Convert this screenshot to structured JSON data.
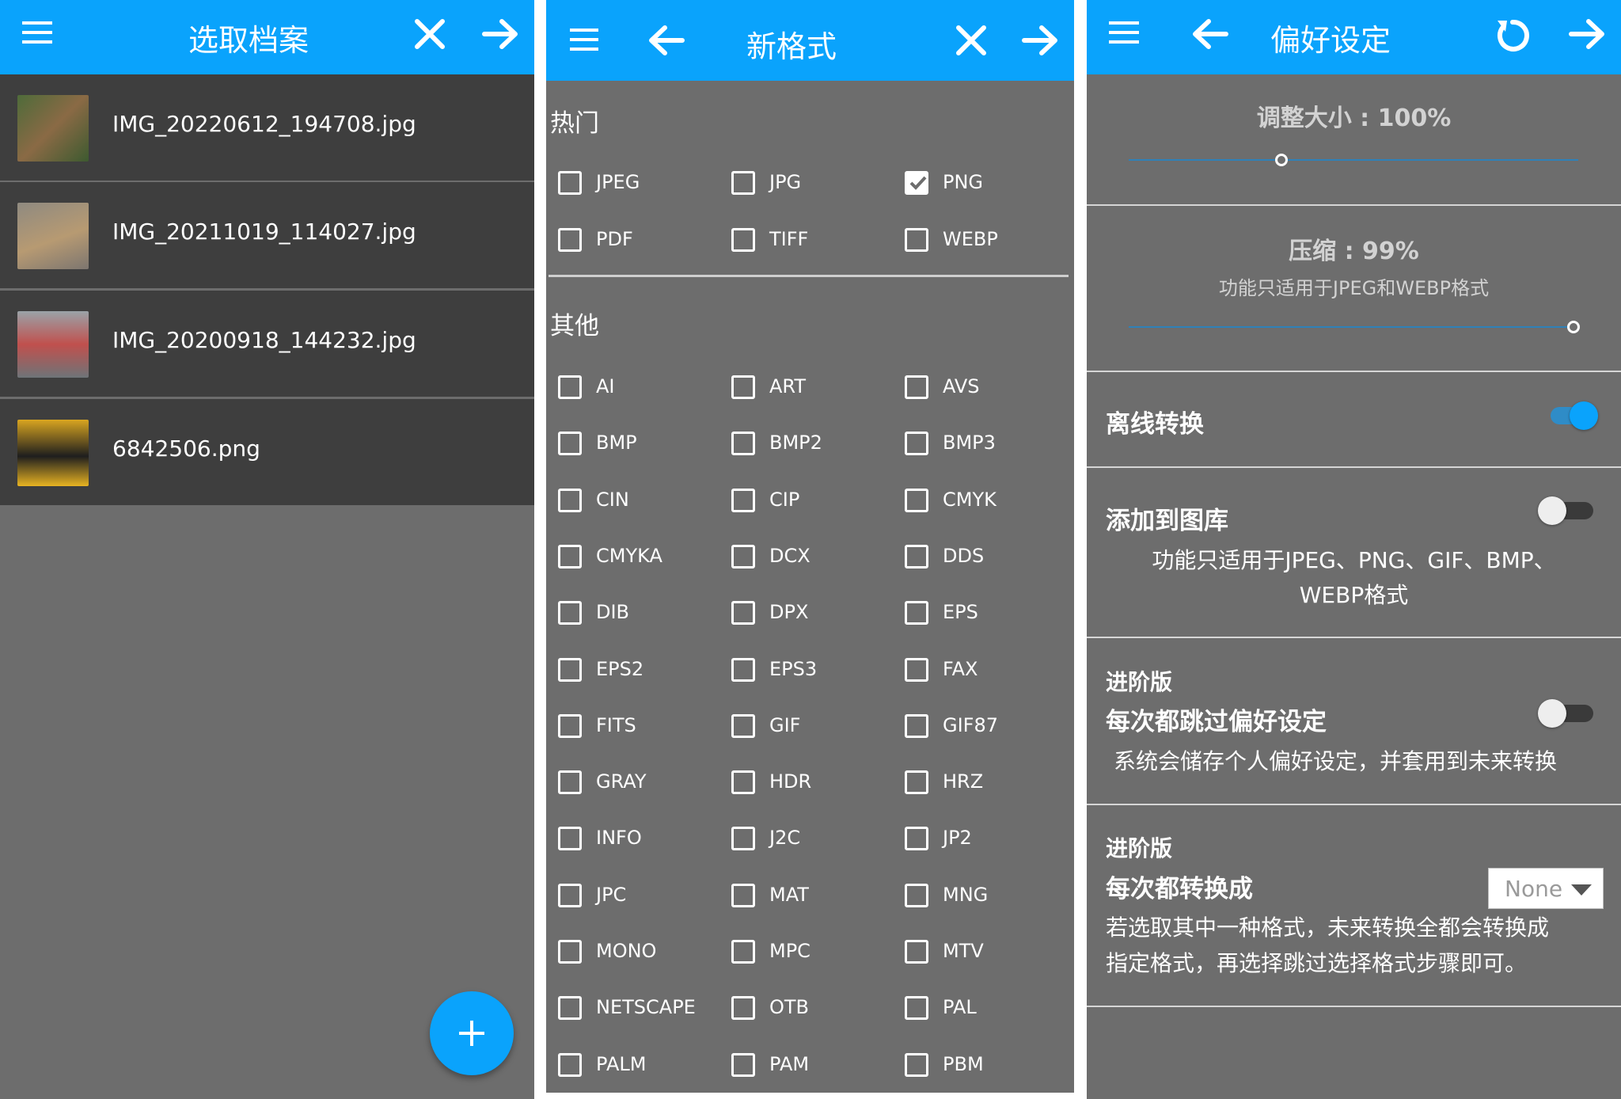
{
  "colors": {
    "accent": "#0aa3fc",
    "panel_bg": "#6d6d6d",
    "row_bg": "#3e3e3e",
    "toggle_on": "#0aa3fc",
    "toggle_off": "#eeeeee"
  },
  "file_picker": {
    "title": "选取档案",
    "files": [
      {
        "name": "IMG_20220612_194708.jpg"
      },
      {
        "name": "IMG_20211019_114027.jpg"
      },
      {
        "name": "IMG_20200918_144232.jpg"
      },
      {
        "name": "6842506.png"
      }
    ],
    "fab_label": "+"
  },
  "format_picker": {
    "title": "新格式",
    "popular_label": "热门",
    "popular": [
      {
        "label": "JPEG",
        "checked": false
      },
      {
        "label": "JPG",
        "checked": false
      },
      {
        "label": "PNG",
        "checked": true
      },
      {
        "label": "PDF",
        "checked": false
      },
      {
        "label": "TIFF",
        "checked": false
      },
      {
        "label": "WEBP",
        "checked": false
      }
    ],
    "other_label": "其他",
    "other": [
      "AI",
      "ART",
      "AVS",
      "BMP",
      "BMP2",
      "BMP3",
      "CIN",
      "CIP",
      "CMYK",
      "CMYKA",
      "DCX",
      "DDS",
      "DIB",
      "DPX",
      "EPS",
      "EPS2",
      "EPS3",
      "FAX",
      "FITS",
      "GIF",
      "GIF87",
      "GRAY",
      "HDR",
      "HRZ",
      "INFO",
      "J2C",
      "JP2",
      "JPC",
      "MAT",
      "MNG",
      "MONO",
      "MPC",
      "MTV",
      "NETSCAPE",
      "OTB",
      "PAL",
      "PALM",
      "PAM",
      "PBM"
    ]
  },
  "preferences": {
    "title": "偏好设定",
    "resize": {
      "label": "调整大小 : 100%",
      "value_percent": 100,
      "slider_fraction": 0.34
    },
    "compress": {
      "label": "压缩 : 99%",
      "value_percent": 99,
      "note": "功能只适用于JPEG和WEBP格式",
      "slider_fraction": 0.99
    },
    "offline": {
      "title": "离线转换",
      "enabled": true
    },
    "gallery": {
      "title": "添加到图库",
      "enabled": false,
      "note_line1": "功能只适用于JPEG、PNG、GIF、BMP、",
      "note_line2": "WEBP格式"
    },
    "skip": {
      "tag": "进阶版",
      "title": "每次都跳过偏好设定",
      "enabled": false,
      "note": "系统会储存个人偏好设定，并套用到未来转换"
    },
    "always": {
      "tag": "进阶版",
      "title": "每次都转换成",
      "dropdown_value": "None",
      "note_line1": "若选取其中一种格式，未来转换全都会转换成",
      "note_line2": "指定格式，再选择跳过选择格式步骤即可。"
    }
  }
}
